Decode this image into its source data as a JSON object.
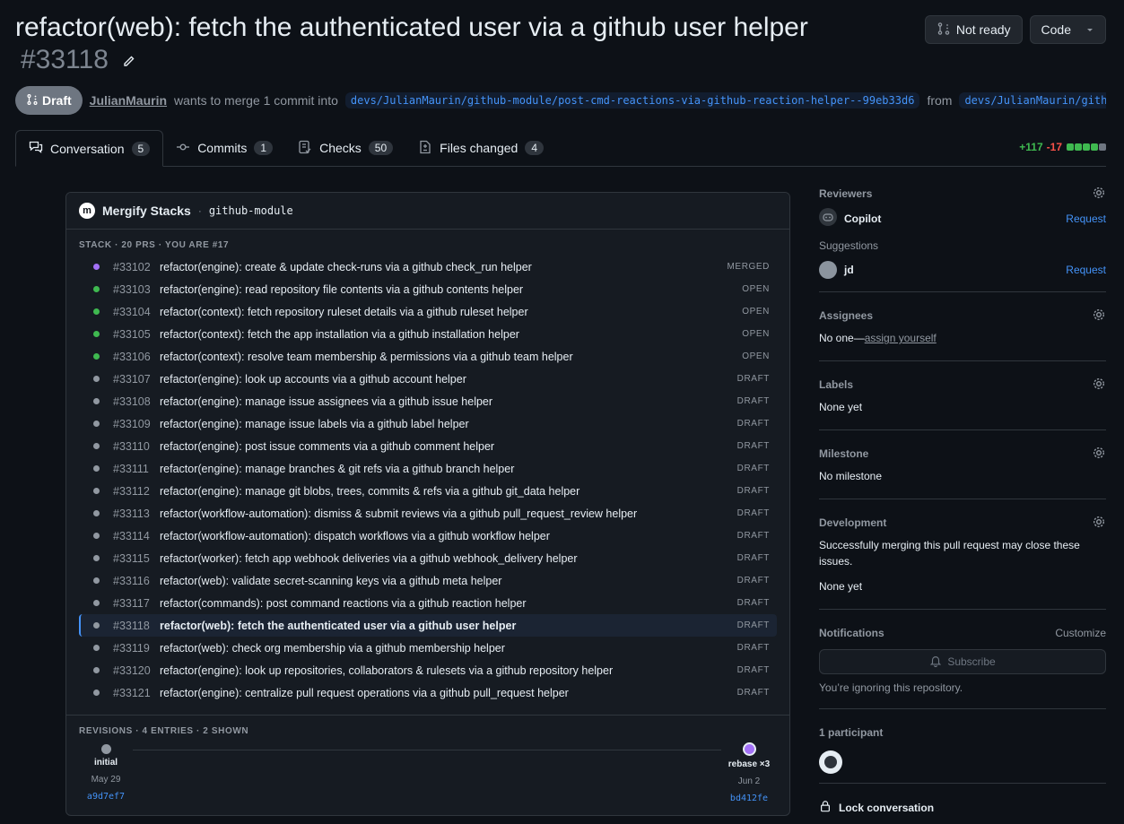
{
  "header": {
    "title": "refactor(web): fetch the authenticated user via a github user helper",
    "number": "#33118",
    "not_ready_label": "Not ready",
    "code_label": "Code"
  },
  "meta": {
    "state": "Draft",
    "author": "JulianMaurin",
    "text": "wants to merge 1 commit into",
    "base_branch": "devs/JulianMaurin/github-module/post-cmd-reactions-via-github-reaction-helper--99eb33d6",
    "from": "from",
    "head_branch": "devs/JulianMaurin/github-module/fetch-authenticated-user"
  },
  "tabs": [
    {
      "label": "Conversation",
      "count": "5"
    },
    {
      "label": "Commits",
      "count": "1"
    },
    {
      "label": "Checks",
      "count": "50"
    },
    {
      "label": "Files changed",
      "count": "4"
    }
  ],
  "diffstat": {
    "additions": "+117",
    "deletions": "-17"
  },
  "stack": {
    "title": "Mergify Stacks",
    "sep": "·",
    "module": "github-module",
    "label": "STACK · 20 PRS · YOU ARE #17",
    "rows": [
      {
        "num": "#33102",
        "title": "refactor(engine): create & update check-runs via a github check_run helper",
        "status": "MERGED"
      },
      {
        "num": "#33103",
        "title": "refactor(engine): read repository file contents via a github contents helper",
        "status": "OPEN"
      },
      {
        "num": "#33104",
        "title": "refactor(context): fetch repository ruleset details via a github ruleset helper",
        "status": "OPEN"
      },
      {
        "num": "#33105",
        "title": "refactor(context): fetch the app installation via a github installation helper",
        "status": "OPEN"
      },
      {
        "num": "#33106",
        "title": "refactor(context): resolve team membership & permissions via a github team helper",
        "status": "OPEN"
      },
      {
        "num": "#33107",
        "title": "refactor(engine): look up accounts via a github account helper",
        "status": "DRAFT"
      },
      {
        "num": "#33108",
        "title": "refactor(engine): manage issue assignees via a github issue helper",
        "status": "DRAFT"
      },
      {
        "num": "#33109",
        "title": "refactor(engine): manage issue labels via a github label helper",
        "status": "DRAFT"
      },
      {
        "num": "#33110",
        "title": "refactor(engine): post issue comments via a github comment helper",
        "status": "DRAFT"
      },
      {
        "num": "#33111",
        "title": "refactor(engine): manage branches & git refs via a github branch helper",
        "status": "DRAFT"
      },
      {
        "num": "#33112",
        "title": "refactor(engine): manage git blobs, trees, commits & refs via a github git_data helper",
        "status": "DRAFT"
      },
      {
        "num": "#33113",
        "title": "refactor(workflow-automation): dismiss & submit reviews via a github pull_request_review helper",
        "status": "DRAFT"
      },
      {
        "num": "#33114",
        "title": "refactor(workflow-automation): dispatch workflows via a github workflow helper",
        "status": "DRAFT"
      },
      {
        "num": "#33115",
        "title": "refactor(worker): fetch app webhook deliveries via a github webhook_delivery helper",
        "status": "DRAFT"
      },
      {
        "num": "#33116",
        "title": "refactor(web): validate secret-scanning keys via a github meta helper",
        "status": "DRAFT"
      },
      {
        "num": "#33117",
        "title": "refactor(commands): post command reactions via a github reaction helper",
        "status": "DRAFT"
      },
      {
        "num": "#33118",
        "title": "refactor(web): fetch the authenticated user via a github user helper",
        "status": "DRAFT"
      },
      {
        "num": "#33119",
        "title": "refactor(web): check org membership via a github membership helper",
        "status": "DRAFT"
      },
      {
        "num": "#33120",
        "title": "refactor(engine): look up repositories, collaborators & rulesets via a github repository helper",
        "status": "DRAFT"
      },
      {
        "num": "#33121",
        "title": "refactor(engine): centralize pull request operations via a github pull_request helper",
        "status": "DRAFT"
      }
    ],
    "current_index": 16
  },
  "revisions": {
    "label": "REVISIONS · 4 ENTRIES · 2 SHOWN",
    "first": {
      "name": "initial",
      "date": "May 29",
      "sha": "a9d7ef7"
    },
    "last": {
      "name": "rebase ×3",
      "date": "Jun 2",
      "sha": "bd412fe"
    }
  },
  "sidebar": {
    "reviewers": {
      "title": "Reviewers",
      "copilot": "Copilot",
      "request": "Request",
      "suggestions": "Suggestions",
      "suggested": "jd"
    },
    "assignees": {
      "title": "Assignees",
      "none": "No one—",
      "assign": "assign yourself"
    },
    "labels": {
      "title": "Labels",
      "value": "None yet"
    },
    "milestone": {
      "title": "Milestone",
      "value": "No milestone"
    },
    "development": {
      "title": "Development",
      "text": "Successfully merging this pull request may close these issues.",
      "value": "None yet"
    },
    "notifications": {
      "title": "Notifications",
      "customize": "Customize",
      "subscribe": "Subscribe",
      "note": "You’re ignoring this repository."
    },
    "participants": {
      "title": "1 participant"
    },
    "lock": "Lock conversation"
  },
  "colors": {
    "merged": "#a371f7",
    "open": "#3fb950",
    "draft": "#9198a1",
    "accent": "#4493f8"
  }
}
